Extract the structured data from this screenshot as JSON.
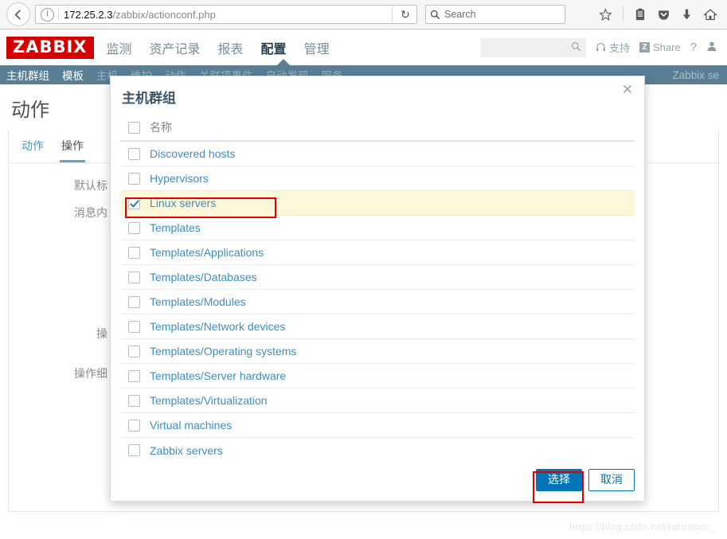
{
  "browser": {
    "back_icon": "back-arrow-icon",
    "info_icon": "page-info-icon",
    "url_host": "172.25.2.3",
    "url_path": "/zabbix/actionconf.php",
    "reload_glyph": "↻",
    "search_placeholder": "Search",
    "toolbar_icons": [
      "bookmark-star-icon",
      "library-icon",
      "pocket-icon",
      "downloads-icon",
      "home-icon"
    ]
  },
  "zabbix_header": {
    "logo": "ZABBIX",
    "nav": [
      {
        "label": "监测",
        "active": false
      },
      {
        "label": "资产记录",
        "active": false
      },
      {
        "label": "报表",
        "active": false
      },
      {
        "label": "配置",
        "active": true
      },
      {
        "label": "管理",
        "active": false
      }
    ],
    "search_value": "",
    "support_label": "支持",
    "share_label": "Share",
    "share_badge": "Z",
    "help_label": "?",
    "user_icon": "user-profile-icon",
    "search_icon": "search-icon",
    "support_icon": "headset-icon"
  },
  "zabbix_submenu": {
    "items": [
      {
        "label": "主机群组"
      },
      {
        "label": "模板"
      },
      {
        "label": "主机"
      },
      {
        "label": "维护"
      },
      {
        "label": "动作"
      },
      {
        "label": "关联项事件"
      },
      {
        "label": "自动发现"
      },
      {
        "label": "服务"
      }
    ],
    "right_text": "Zabbix se"
  },
  "page": {
    "title": "动作",
    "tabs": [
      {
        "label": "动作",
        "active": false
      },
      {
        "label": "操作",
        "active": true
      }
    ],
    "labels": {
      "default_subject": "默认标",
      "message_content": "消息内",
      "operations": "操",
      "operation_details": "操作细"
    }
  },
  "modal": {
    "title": "主机群组",
    "close_icon": "close-icon",
    "column_header": "名称",
    "header_checkbox_checked": false,
    "rows": [
      {
        "label": "Discovered hosts",
        "checked": false
      },
      {
        "label": "Hypervisors",
        "checked": false
      },
      {
        "label": "Linux servers",
        "checked": true
      },
      {
        "label": "Templates",
        "checked": false
      },
      {
        "label": "Templates/Applications",
        "checked": false
      },
      {
        "label": "Templates/Databases",
        "checked": false
      },
      {
        "label": "Templates/Modules",
        "checked": false
      },
      {
        "label": "Templates/Network devices",
        "checked": false
      },
      {
        "label": "Templates/Operating systems",
        "checked": false
      },
      {
        "label": "Templates/Server hardware",
        "checked": false
      },
      {
        "label": "Templates/Virtualization",
        "checked": false
      },
      {
        "label": "Virtual machines",
        "checked": false
      },
      {
        "label": "Zabbix servers",
        "checked": false
      }
    ],
    "select_button": "选择",
    "cancel_button": "取消"
  },
  "annotations": {
    "highlight_color": "#e00000",
    "selected_row_color": "#fdf7da"
  },
  "watermark": "https://blog.csdn.net/ranrancc_"
}
